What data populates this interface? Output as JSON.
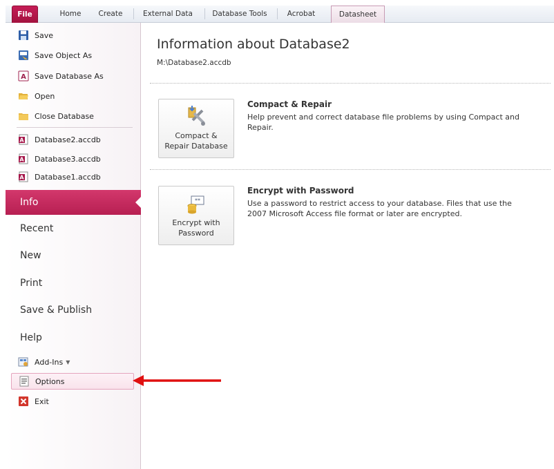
{
  "ribbon": {
    "tabs": [
      {
        "label": "File"
      },
      {
        "label": "Home"
      },
      {
        "label": "Create"
      },
      {
        "label": "External Data"
      },
      {
        "label": "Database Tools"
      },
      {
        "label": "Acrobat"
      },
      {
        "label": "Datasheet"
      }
    ],
    "active_tab_color": "#b7164a",
    "contextual_tab": "Datasheet"
  },
  "backstage": {
    "commands": [
      {
        "label": "Save",
        "icon": "floppy-disk-icon"
      },
      {
        "label": "Save Object As",
        "icon": "save-object-icon"
      },
      {
        "label": "Save Database As",
        "icon": "access-db-icon"
      },
      {
        "label": "Open",
        "icon": "open-folder-icon"
      },
      {
        "label": "Close Database",
        "icon": "folder-icon"
      }
    ],
    "recent_files": [
      {
        "label": "Database2.accdb",
        "icon": "access-file-icon"
      },
      {
        "label": "Database3.accdb",
        "icon": "access-file-icon"
      },
      {
        "label": "Database1.accdb",
        "icon": "access-file-icon"
      }
    ],
    "sections": [
      {
        "label": "Info",
        "active": true
      },
      {
        "label": "Recent"
      },
      {
        "label": "New"
      },
      {
        "label": "Print"
      },
      {
        "label": "Save & Publish"
      },
      {
        "label": "Help"
      }
    ],
    "bottom": [
      {
        "label": "Add-Ins",
        "icon": "add-ins-icon",
        "dropdown": true
      },
      {
        "label": "Options",
        "icon": "options-icon",
        "highlighted": true
      },
      {
        "label": "Exit",
        "icon": "exit-icon"
      }
    ],
    "active_color": "#c42a5e"
  },
  "info": {
    "title": "Information about Database2",
    "path": "M:\\Database2.accdb",
    "compact": {
      "button_label": "Compact &\nRepair Database",
      "title": "Compact & Repair",
      "description": "Help prevent and correct database file problems by using Compact and Repair."
    },
    "encrypt": {
      "button_label": "Encrypt with\nPassword",
      "title": "Encrypt with Password",
      "description": "Use a password to restrict access to your database. Files that use the 2007 Microsoft Access file format or later are encrypted."
    }
  },
  "annotation": {
    "color": "#e01010",
    "points_to": "Options"
  }
}
